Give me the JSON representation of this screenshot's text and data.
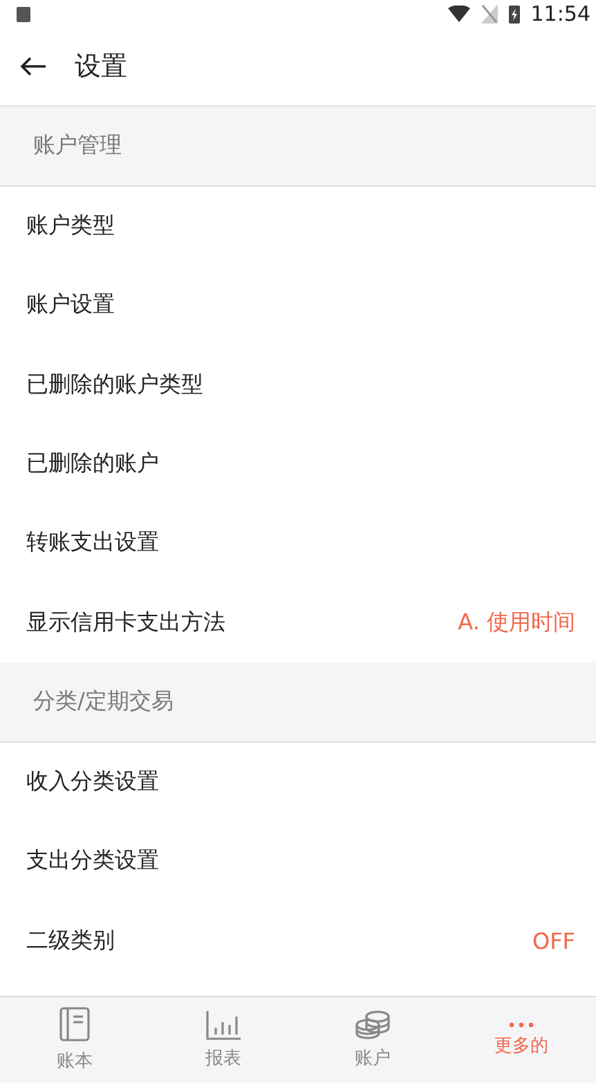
{
  "status_bar": {
    "time": "11:54"
  },
  "app_bar": {
    "title": "设置"
  },
  "sections": [
    {
      "title": "账户管理",
      "items": [
        {
          "label": "账户类型"
        },
        {
          "label": "账户设置"
        },
        {
          "label": "已删除的账户类型"
        },
        {
          "label": "已删除的账户"
        },
        {
          "label": "转账支出设置"
        },
        {
          "label": "显示信用卡支出方法",
          "value": "A. 使用时间"
        }
      ]
    },
    {
      "title": "分类/定期交易",
      "items": [
        {
          "label": "收入分类设置"
        },
        {
          "label": "支出分类设置"
        },
        {
          "label": "二级类别",
          "value": "OFF"
        }
      ]
    }
  ],
  "bottom_nav": [
    {
      "kind": "book",
      "label": "账本",
      "selected": false
    },
    {
      "kind": "chart",
      "label": "报表",
      "selected": false
    },
    {
      "kind": "coins",
      "label": "账户",
      "selected": false
    },
    {
      "kind": "more",
      "label": "更多的",
      "selected": true
    }
  ]
}
